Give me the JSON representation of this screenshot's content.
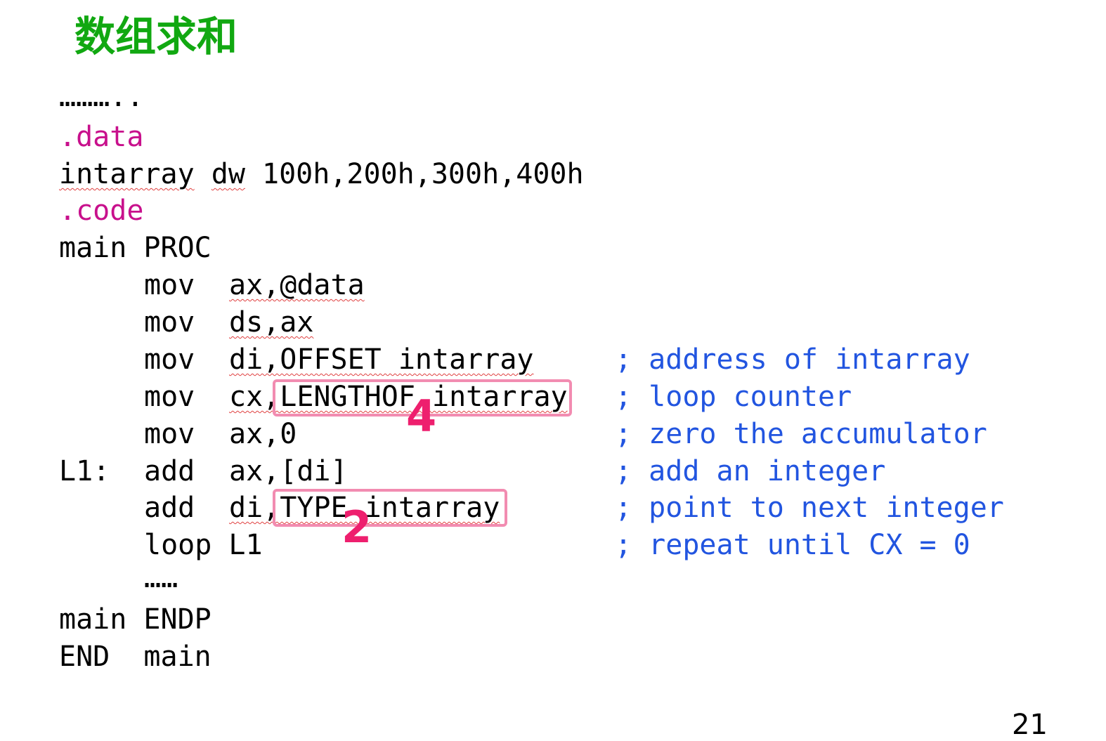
{
  "title": "数组求和",
  "lines": {
    "ellipsis_top": "………..",
    "data_directive": ".data",
    "decl_name": "intarray",
    "decl_type": "dw",
    "decl_values": "100h,200h,300h,400h",
    "code_directive": ".code",
    "main_proc": "main PROC",
    "mov1_op": "mov",
    "mov1_args": "ax,@data",
    "mov2_op": "mov",
    "mov2_args": "ds,ax",
    "mov3_op": "mov",
    "mov3_args": "di,OFFSET intarray",
    "mov3_comment": "; address of intarray",
    "mov4_op": "mov",
    "mov4_args": "cx,LENGTHOF intarray",
    "mov4_comment": "; loop counter",
    "mov5_op": "mov",
    "mov5_args": "ax,0",
    "mov5_comment": "; zero the accumulator",
    "l1_label": "L1:",
    "add1_op": "add",
    "add1_args": "ax,[di]",
    "add1_comment": "; add an integer",
    "add2_op": "add",
    "add2_args": "di,TYPE intarray",
    "add2_comment": "; point to next integer",
    "loop_instr": "loop L1",
    "loop_comment": "; repeat until CX = 0",
    "ellipsis_mid": "……",
    "main_endp": "main ENDP",
    "end_main": "END  main"
  },
  "annotations": {
    "lengthof_value": "4",
    "type_value": "2"
  },
  "page_number": "21",
  "colors": {
    "title": "#11a811",
    "directive": "#c8108c",
    "comment": "#2255e0",
    "highlight_box": "#f28cb1",
    "annotation_number": "#ee1f6e"
  }
}
